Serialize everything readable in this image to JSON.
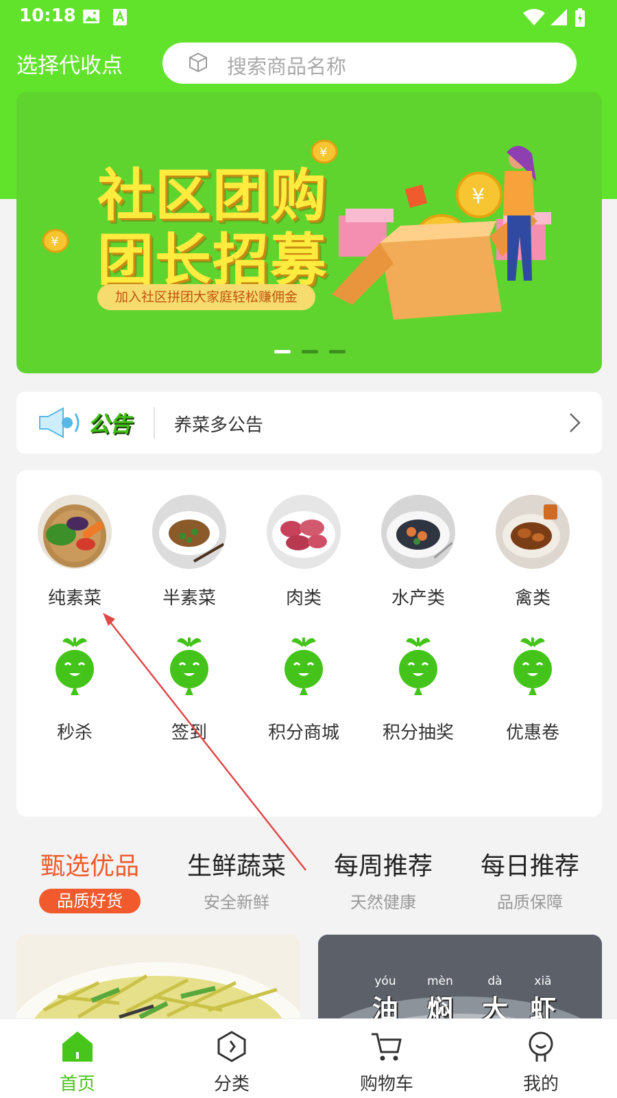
{
  "status_bar": {
    "time": "10:18"
  },
  "header": {
    "pickup_label": "选择代收点",
    "search_placeholder": "搜索商品名称"
  },
  "banner": {
    "title_line1": "社区团购",
    "title_line2": "团长招募",
    "subtitle": "加入社区拼团大家庭轻松赚佣金",
    "page_count": 3,
    "active_page": 1
  },
  "notice": {
    "badge": "公告",
    "text": "养菜多公告"
  },
  "categories": [
    {
      "label": "纯素菜",
      "icon": "vegetable-basket-photo"
    },
    {
      "label": "半素菜",
      "icon": "mixed-dish-photo"
    },
    {
      "label": "肉类",
      "icon": "meat-photo"
    },
    {
      "label": "水产类",
      "icon": "seafood-photo"
    },
    {
      "label": "禽类",
      "icon": "poultry-photo"
    }
  ],
  "functions": [
    {
      "label": "秒杀",
      "icon": "radish-mascot-icon"
    },
    {
      "label": "签到",
      "icon": "radish-mascot-icon"
    },
    {
      "label": "积分商城",
      "icon": "radish-mascot-icon"
    },
    {
      "label": "积分抽奖",
      "icon": "radish-mascot-icon"
    },
    {
      "label": "优惠卷",
      "icon": "radish-mascot-icon"
    }
  ],
  "feature_tabs": [
    {
      "title": "甄选优品",
      "subtitle": "品质好货",
      "active": true
    },
    {
      "title": "生鲜蔬菜",
      "subtitle": "安全新鲜",
      "active": false
    },
    {
      "title": "每周推荐",
      "subtitle": "天然健康",
      "active": false
    },
    {
      "title": "每日推荐",
      "subtitle": "品质保障",
      "active": false
    }
  ],
  "products": [
    {
      "image": "shredded-potato-photo"
    },
    {
      "image": "braised-shrimp-photo",
      "pinyin": [
        "yóu",
        "mèn",
        "dà",
        "xiā"
      ],
      "hanzi": [
        "油",
        "焖",
        "大",
        "虾"
      ]
    }
  ],
  "bottom_nav": [
    {
      "label": "首页",
      "icon": "home-icon",
      "active": true
    },
    {
      "label": "分类",
      "icon": "category-icon",
      "active": false
    },
    {
      "label": "购物车",
      "icon": "cart-icon",
      "active": false
    },
    {
      "label": "我的",
      "icon": "profile-icon",
      "active": false
    }
  ],
  "colors": {
    "brand_green": "#62e32b",
    "active_orange": "#f05a2c",
    "nav_active": "#48c51b",
    "annotation_red": "#e04848"
  }
}
